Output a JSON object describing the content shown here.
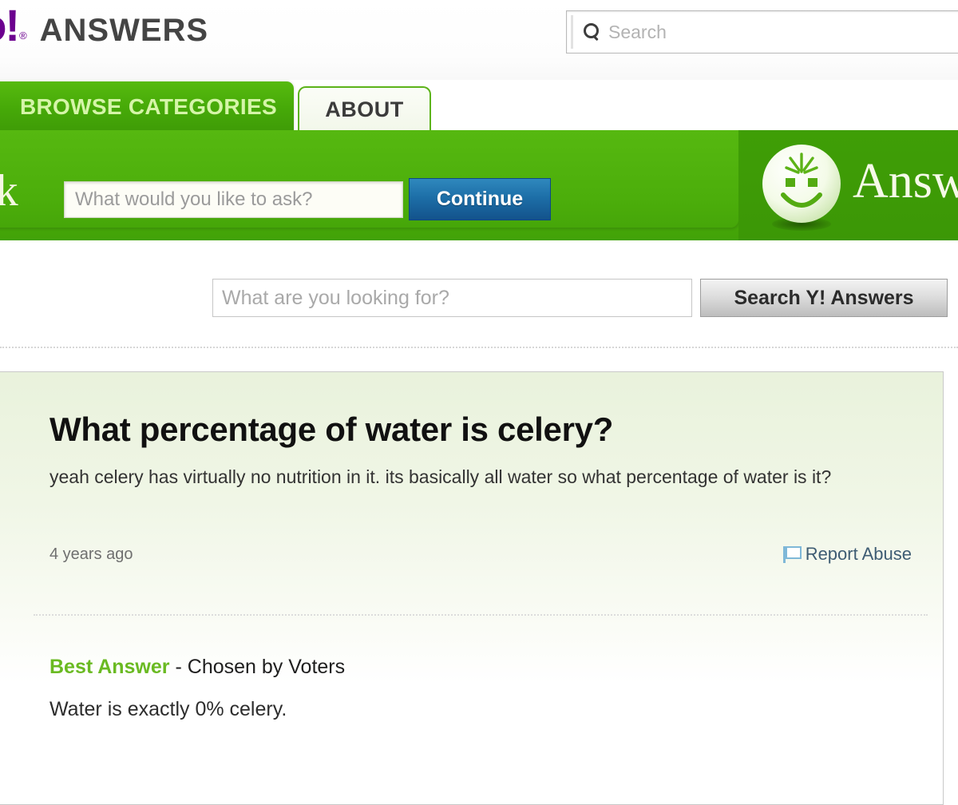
{
  "brand": {
    "yahoo_fragment": "oo!",
    "registered_mark": "®",
    "product": "ANSWERS"
  },
  "top_search": {
    "icon": "search-icon",
    "placeholder": "Search",
    "value": ""
  },
  "tabs": [
    {
      "id": "browse-categories",
      "label": "BROWSE CATEGORIES",
      "active": true
    },
    {
      "id": "about",
      "label": "ABOUT",
      "active": false
    }
  ],
  "ask_bar": {
    "ask_word": "sk",
    "input_placeholder": "What would you like to ask?",
    "input_value": "",
    "continue_label": "Continue",
    "mascot_icon": "smiley-mascot-icon",
    "wordmark": "Answ"
  },
  "site_search": {
    "placeholder": "What are you looking for?",
    "value": "",
    "button_label": "Search Y! Answers"
  },
  "question": {
    "title": "What percentage of water is celery?",
    "body": "yeah celery has virtually no nutrition in it. its basically all water so what percentage of water is it?",
    "time_ago": "4 years ago",
    "report_abuse_label": "Report Abuse",
    "report_abuse_icon": "flag-icon"
  },
  "answer": {
    "best_answer_label": "Best Answer",
    "chosen_by": "- Chosen by Voters",
    "text": "Water is exactly 0% celery."
  },
  "colors": {
    "yahoo_purple": "#6c008f",
    "brand_gray": "#444444",
    "green_bar": "#4aad0a",
    "green_dark": "#3f9e06",
    "tab_label": "#d5f5a8",
    "continue_blue": "#1d6fa8",
    "best_answer_green": "#6aba22",
    "report_link_blue": "#3e5c73",
    "panel_green_tint": "#e9f2dc"
  }
}
